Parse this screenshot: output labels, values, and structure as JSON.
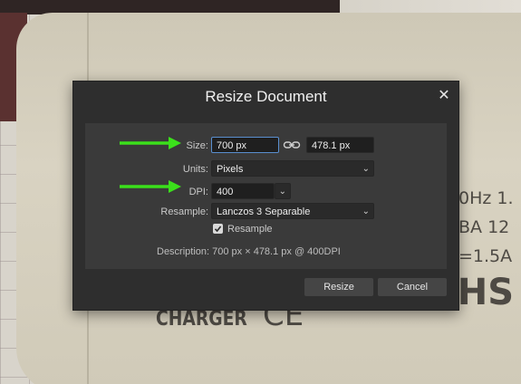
{
  "background": {
    "printed_text": [
      "CHARGER",
      "CE",
      "ROHS",
      "0Hz 1.",
      "BA 12",
      "=1.5A"
    ]
  },
  "dialog": {
    "title": "Resize Document",
    "close_icon": "close-icon",
    "size_label": "Size:",
    "width_value": "700 px",
    "height_value": "478.1 px",
    "link_icon": "chain-link-icon",
    "units_label": "Units:",
    "units_value": "Pixels",
    "dpi_label": "DPI:",
    "dpi_value": "400",
    "resample_label": "Resample:",
    "resample_value": "Lanczos 3 Separable",
    "resample_checkbox_label": "Resample",
    "resample_checked": true,
    "description": "Description: 700 px × 478.1 px @ 400DPI",
    "resize_button": "Resize",
    "cancel_button": "Cancel"
  },
  "annotations": {
    "arrow_color": "#3be01b",
    "arrows": [
      "size-arrow",
      "dpi-arrow"
    ]
  },
  "colors": {
    "dialog_bg": "#2e2e2e",
    "panel_bg": "#3a3a3a",
    "active_field_border": "#5a8fcf"
  }
}
